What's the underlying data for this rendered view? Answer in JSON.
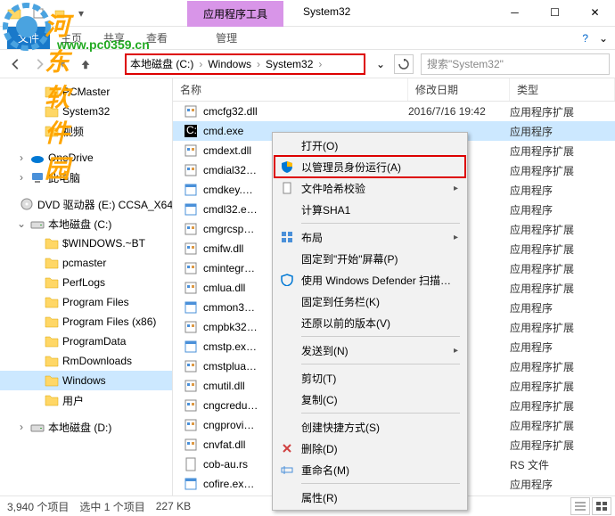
{
  "window": {
    "title": "System32",
    "tab": "应用程序工具",
    "subtab": "管理"
  },
  "menu": {
    "file": "文件",
    "home": "主页",
    "share": "共享",
    "view": "查看"
  },
  "watermark": {
    "name": "河东软件园",
    "url": "www.pc0359.cn"
  },
  "breadcrumb": {
    "drive": "本地磁盘 (C:)",
    "win": "Windows",
    "sys": "System32"
  },
  "search": {
    "placeholder": "搜索\"System32\""
  },
  "columns": {
    "name": "名称",
    "date": "修改日期",
    "type": "类型"
  },
  "tree": [
    {
      "label": "PCMaster",
      "icon": "folder",
      "lvl": 2
    },
    {
      "label": "System32",
      "icon": "folder",
      "lvl": 2
    },
    {
      "label": "视频",
      "icon": "folder",
      "lvl": 2
    },
    {
      "label": "OneDrive",
      "icon": "onedrive",
      "lvl": 1,
      "exp": ">",
      "blank": true
    },
    {
      "label": "此电脑",
      "icon": "pc",
      "lvl": 1,
      "exp": ">"
    },
    {
      "label": "DVD 驱动器 (E:) CCSA_X64…",
      "icon": "dvd",
      "lvl": 1,
      "exp": "",
      "blank": true
    },
    {
      "label": "本地磁盘 (C:)",
      "icon": "drive",
      "lvl": 1,
      "exp": "v"
    },
    {
      "label": "$WINDOWS.~BT",
      "icon": "folder",
      "lvl": 2
    },
    {
      "label": "pcmaster",
      "icon": "folder",
      "lvl": 2
    },
    {
      "label": "PerfLogs",
      "icon": "folder",
      "lvl": 2
    },
    {
      "label": "Program Files",
      "icon": "folder",
      "lvl": 2
    },
    {
      "label": "Program Files (x86)",
      "icon": "folder",
      "lvl": 2
    },
    {
      "label": "ProgramData",
      "icon": "folder",
      "lvl": 2
    },
    {
      "label": "RmDownloads",
      "icon": "folder",
      "lvl": 2
    },
    {
      "label": "Windows",
      "icon": "folder",
      "lvl": 2,
      "sel": true
    },
    {
      "label": "用户",
      "icon": "folder",
      "lvl": 2
    },
    {
      "label": "本地磁盘 (D:)",
      "icon": "drive",
      "lvl": 1,
      "exp": ">",
      "blank": true
    }
  ],
  "files": [
    {
      "name": "cmcfg32.dll",
      "date": "2016/7/16 19:42",
      "type": "应用程序扩展",
      "icon": "dll"
    },
    {
      "name": "cmd.exe",
      "date": "",
      "type": "应用程序",
      "icon": "exe",
      "sel": true
    },
    {
      "name": "cmdext.dll",
      "date": "",
      "type": "应用程序扩展",
      "icon": "dll"
    },
    {
      "name": "cmdial32…",
      "date": "",
      "type": "应用程序扩展",
      "icon": "dll"
    },
    {
      "name": "cmdkey.…",
      "date": "",
      "type": "应用程序",
      "icon": "exe2"
    },
    {
      "name": "cmdl32.e…",
      "date": "",
      "type": "应用程序",
      "icon": "exe2"
    },
    {
      "name": "cmgrcsp…",
      "date": "",
      "type": "应用程序扩展",
      "icon": "dll"
    },
    {
      "name": "cmifw.dll",
      "date": "",
      "type": "应用程序扩展",
      "icon": "dll"
    },
    {
      "name": "cmintegr…",
      "date": "",
      "type": "应用程序扩展",
      "icon": "dll"
    },
    {
      "name": "cmlua.dll",
      "date": "",
      "type": "应用程序扩展",
      "icon": "dll"
    },
    {
      "name": "cmmon3…",
      "date": "",
      "type": "应用程序",
      "icon": "exe2"
    },
    {
      "name": "cmpbk32…",
      "date": "",
      "type": "应用程序扩展",
      "icon": "dll"
    },
    {
      "name": "cmstp.ex…",
      "date": "",
      "type": "应用程序",
      "icon": "exe2"
    },
    {
      "name": "cmstplua…",
      "date": "",
      "type": "应用程序扩展",
      "icon": "dll"
    },
    {
      "name": "cmutil.dll",
      "date": "",
      "type": "应用程序扩展",
      "icon": "dll"
    },
    {
      "name": "cngcredu…",
      "date": "",
      "type": "应用程序扩展",
      "icon": "dll"
    },
    {
      "name": "cngprovi…",
      "date": "",
      "type": "应用程序扩展",
      "icon": "dll"
    },
    {
      "name": "cnvfat.dll",
      "date": "",
      "type": "应用程序扩展",
      "icon": "dll"
    },
    {
      "name": "cob-au.rs",
      "date": "",
      "type": "RS 文件",
      "icon": "rs"
    },
    {
      "name": "cofire.ex…",
      "date": "",
      "type": "应用程序",
      "icon": "exe2"
    }
  ],
  "context": [
    {
      "label": "打开(O)"
    },
    {
      "label": "以管理员身份运行(A)",
      "icon": "shield",
      "hl": true
    },
    {
      "label": "文件哈希校验",
      "sub": true,
      "icon": "doc"
    },
    {
      "label": "计算SHA1"
    },
    {
      "sep": true
    },
    {
      "label": "布局",
      "icon": "grid",
      "sub": true
    },
    {
      "label": "固定到\"开始\"屏幕(P)"
    },
    {
      "label": "使用 Windows Defender 扫描…",
      "icon": "defender"
    },
    {
      "label": "固定到任务栏(K)"
    },
    {
      "label": "还原以前的版本(V)"
    },
    {
      "sep": true
    },
    {
      "label": "发送到(N)",
      "sub": true
    },
    {
      "sep": true
    },
    {
      "label": "剪切(T)"
    },
    {
      "label": "复制(C)"
    },
    {
      "sep": true
    },
    {
      "label": "创建快捷方式(S)"
    },
    {
      "label": "删除(D)",
      "icon": "delete"
    },
    {
      "label": "重命名(M)",
      "icon": "rename"
    },
    {
      "sep": true
    },
    {
      "label": "属性(R)"
    }
  ],
  "status": {
    "count": "3,940 个项目",
    "sel": "选中 1 个项目",
    "size": "227 KB"
  }
}
